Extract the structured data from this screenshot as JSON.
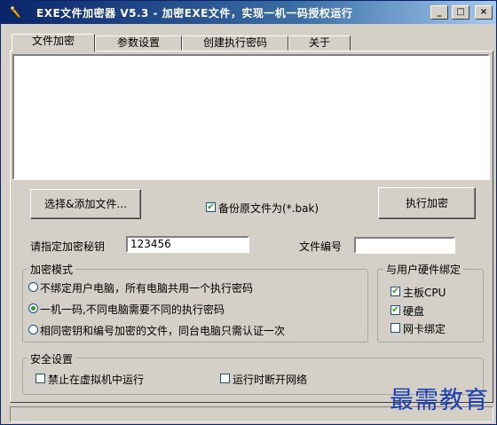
{
  "window": {
    "title": "EXE文件加密器 V5.3 - 加密EXE文件，实现一机一码授权运行",
    "app_icon": "wrench-icon",
    "minimize_glyph": "_",
    "maximize_glyph": "□",
    "close_glyph": "×"
  },
  "tabs": [
    {
      "label": "文件加密"
    },
    {
      "label": "参数设置"
    },
    {
      "label": "创建执行密码"
    },
    {
      "label": "关于"
    }
  ],
  "buttons": {
    "add_files": "选择&添加文件...",
    "encrypt": "执行加密"
  },
  "backup": {
    "label": "备份原文件为(*.bak)",
    "checked": true
  },
  "key": {
    "label": "请指定加密秘钥",
    "value": "123456"
  },
  "file_number": {
    "label": "文件编号",
    "value": ""
  },
  "mode": {
    "title": "加密模式",
    "options": [
      {
        "label": "不绑定用户电脑，所有电脑共用一个执行密码",
        "selected": false
      },
      {
        "label": "一机一码,不同电脑需要不同的执行密码",
        "selected": true
      },
      {
        "label": "相同密钥和编号加密的文件，同台电脑只需认证一次",
        "selected": false
      }
    ]
  },
  "hardware": {
    "title": "与用户硬件绑定",
    "items": [
      {
        "label": "主板CPU",
        "checked": true
      },
      {
        "label": "硬盘",
        "checked": true
      },
      {
        "label": "网卡绑定",
        "checked": false
      }
    ]
  },
  "security": {
    "title": "安全设置",
    "items": [
      {
        "label": "禁止在虚拟机中运行",
        "checked": false
      },
      {
        "label": "运行时断开网络",
        "checked": false
      }
    ]
  },
  "watermark": "最需教育",
  "colors": {
    "check": "#21a121",
    "title_bar": "#0a246a",
    "watermark": "#1a3fb3"
  }
}
